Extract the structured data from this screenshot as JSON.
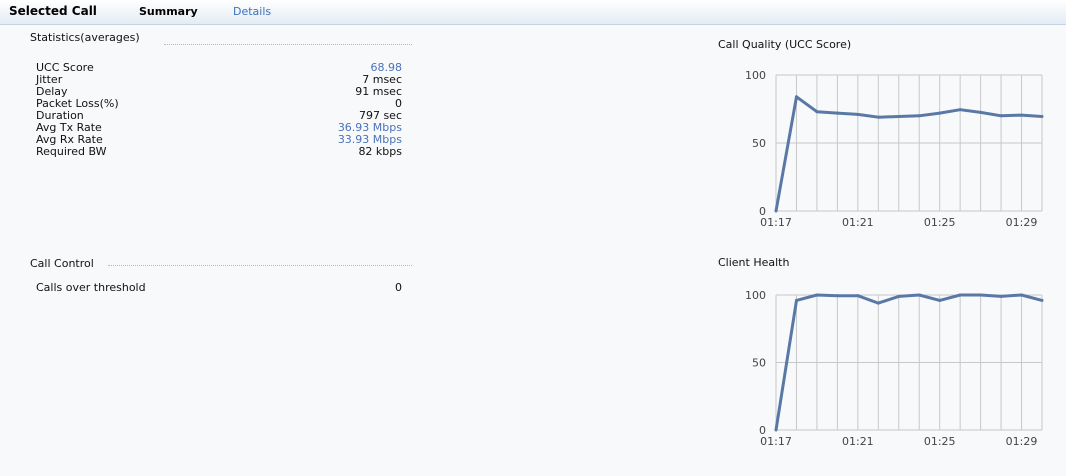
{
  "header": {
    "title": "Selected Call",
    "tabs": [
      {
        "label": "Summary",
        "active": true
      },
      {
        "label": "Details",
        "active": false
      }
    ]
  },
  "statistics": {
    "title": "Statistics(averages)",
    "rows": [
      {
        "label": "UCC Score",
        "value": "68.98",
        "link": true
      },
      {
        "label": "Jitter",
        "value": "7 msec",
        "link": false
      },
      {
        "label": "Delay",
        "value": "91 msec",
        "link": false
      },
      {
        "label": "Packet Loss(%)",
        "value": "0",
        "link": false
      },
      {
        "label": "Duration",
        "value": "797 sec",
        "link": false
      },
      {
        "label": "Avg Tx Rate",
        "value": "36.93 Mbps",
        "link": true
      },
      {
        "label": "Avg Rx Rate",
        "value": "33.93 Mbps",
        "link": true
      },
      {
        "label": "Required BW",
        "value": "82 kbps",
        "link": false
      }
    ]
  },
  "call_control": {
    "title": "Call Control",
    "rows": [
      {
        "label": "Calls over threshold",
        "value": "0"
      }
    ]
  },
  "colors": {
    "link": "#4a72b8",
    "line": "#5a78a6",
    "grid": "#c8c8c8",
    "header_bg": "#e3ebf4"
  },
  "chart_data": [
    {
      "type": "line",
      "title": "Call Quality (UCC Score)",
      "x_ticks": [
        "01:17",
        "01:21",
        "01:25",
        "01:29"
      ],
      "ylim": [
        0,
        100
      ],
      "y_ticks": [
        0,
        50,
        100
      ],
      "grid": true,
      "series": [
        {
          "values": [
            0,
            84,
            73,
            72,
            71,
            69,
            69.5,
            70,
            72,
            74.5,
            72.5,
            70,
            70.5,
            69.5
          ]
        }
      ]
    },
    {
      "type": "line",
      "title": "Client Health",
      "x_ticks": [
        "01:17",
        "01:21",
        "01:25",
        "01:29"
      ],
      "ylim": [
        0,
        100
      ],
      "y_ticks": [
        0,
        50,
        100
      ],
      "grid": true,
      "series": [
        {
          "values": [
            0,
            96,
            100,
            99.5,
            99.5,
            94,
            99,
            100,
            96,
            100,
            100,
            99,
            100,
            96
          ]
        }
      ]
    }
  ]
}
